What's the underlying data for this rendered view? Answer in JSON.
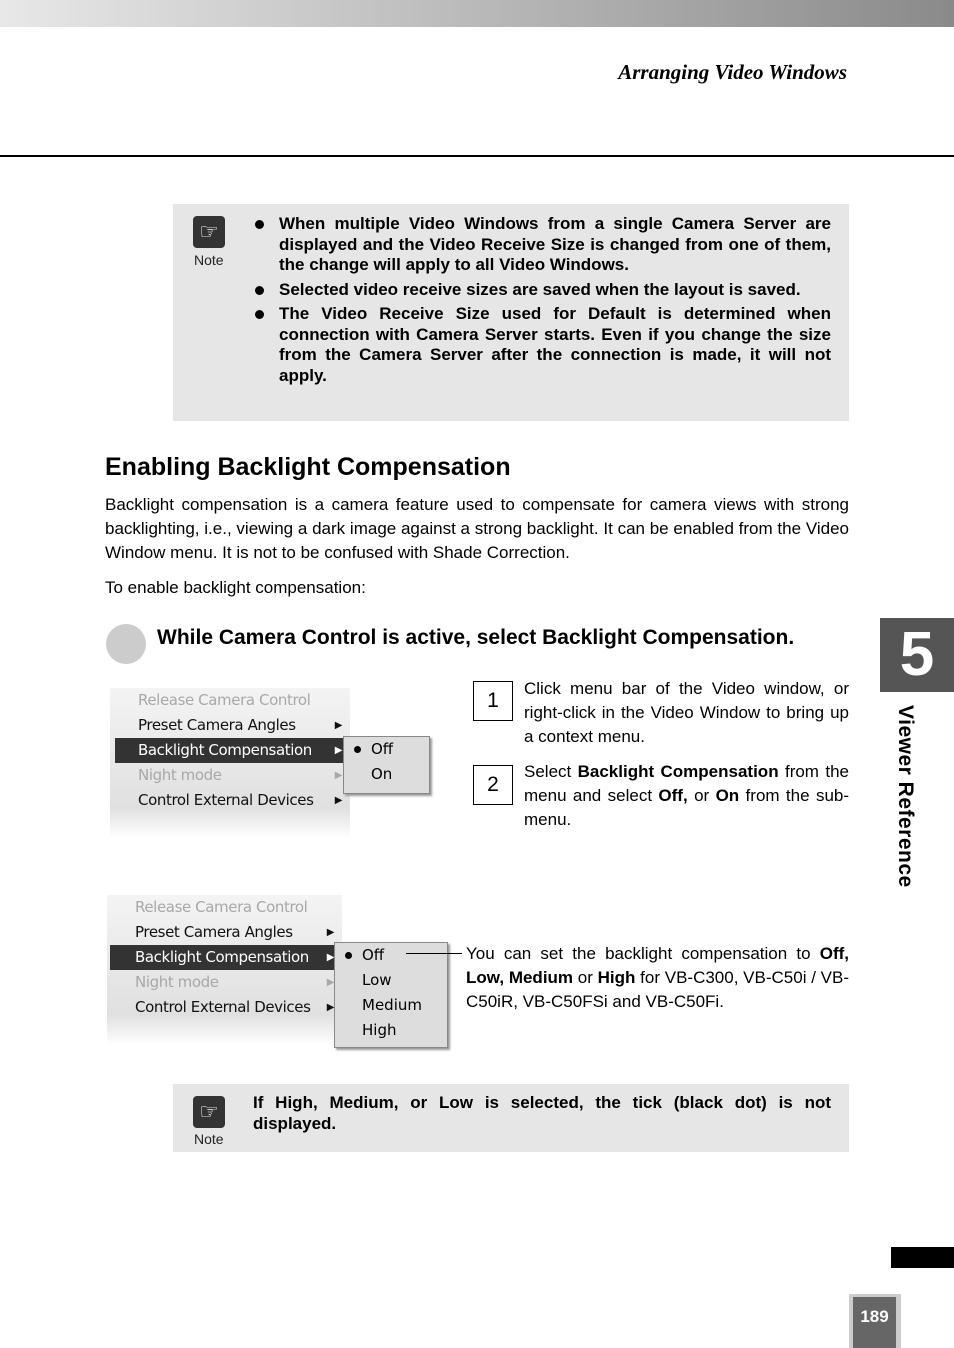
{
  "header": {
    "running_title": "Arranging Video Windows"
  },
  "note1": {
    "label": "Note",
    "icon": "note-hand-icon",
    "items": [
      "When multiple Video Windows from a single Camera Server are displayed and the Video Receive Size is changed from one of them, the change will apply to all Video Windows.",
      "Selected video receive sizes are saved when the layout is saved.",
      "The Video Receive Size used for Default is determined when connection with Camera Server starts. Even if you change the size from the Camera Server after the connection is made, it will not apply."
    ]
  },
  "section": {
    "title": "Enabling Backlight Compensation",
    "para1": "Backlight compensation is a camera feature used to compensate for camera views with strong backlighting, i.e., viewing a dark image against a strong backlight. It can be enabled from the Video Window menu. It is not to be confused with Shade Correction.",
    "para2": "To enable backlight compensation:",
    "step": "While Camera Control is active, select Backlight Compensation."
  },
  "menu1": {
    "items": [
      "Release Camera Control",
      "Preset Camera Angles",
      "Backlight Compensation",
      "Night mode",
      "Control External Devices"
    ],
    "submenu": [
      "Off",
      "On"
    ]
  },
  "menu2": {
    "items": [
      "Release Camera Control",
      "Preset Camera Angles",
      "Backlight Compensation",
      "Night mode",
      "Control External Devices"
    ],
    "submenu": [
      "Off",
      "Low",
      "Medium",
      "High"
    ]
  },
  "steps": [
    {
      "num": "1",
      "text": "Click menu bar of the Video window, or right-click in the Video Window to bring up a context menu."
    },
    {
      "num": "2",
      "pre": "Select ",
      "b1": "Backlight Compensation",
      "mid": " from the menu and select ",
      "b2": "Off,",
      "or": " or ",
      "b3": "On",
      "post": " from the sub-menu."
    }
  ],
  "callout": {
    "pre": "You can set the backlight compensation to ",
    "b": "Off, Low, Medium",
    "or": " or ",
    "b2": "High",
    "post": " for VB-C300, VB-C50i / VB-C50iR, VB-C50FSi and VB-C50Fi."
  },
  "note2": {
    "label": "Note",
    "text": "If High, Medium, or Low is selected, the tick (black dot) is not displayed."
  },
  "side": {
    "chapter": "5",
    "label": "Viewer Reference"
  },
  "footer": {
    "page": "189"
  }
}
